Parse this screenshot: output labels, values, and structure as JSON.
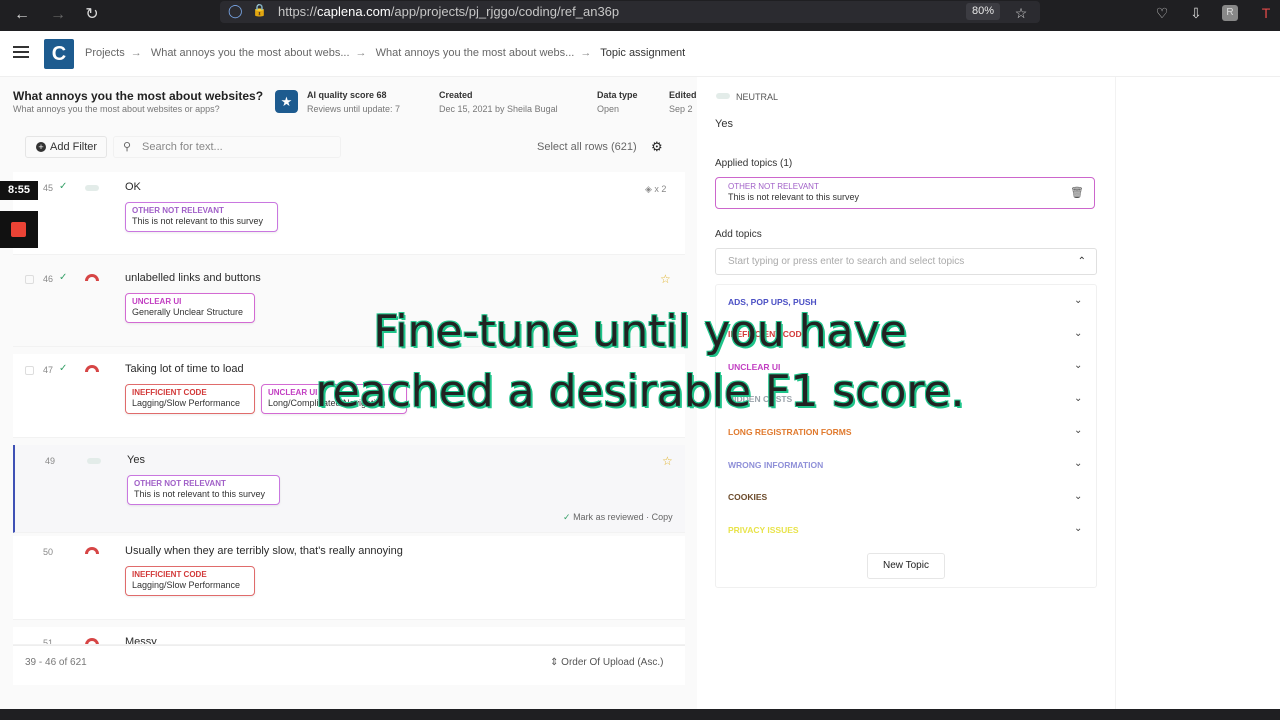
{
  "browser": {
    "url_prefix": "https://",
    "url_domain": "caplena.com",
    "url_path": "/app/projects/pj_rjggo/coding/ref_an36p",
    "zoom": "80%"
  },
  "breadcrumb": [
    "Projects",
    "What annoys you the most about webs...",
    "What annoys you the most about webs...",
    "Topic assignment"
  ],
  "project": {
    "title": "What annoys you the most about websites?",
    "subtitle": "What annoys you the most about websites or apps?",
    "ai_label": "AI quality score 68",
    "ai_sub": "Reviews until update: 7",
    "created_label": "Created",
    "created_value": "Dec 15, 2021 by Sheila Bugal",
    "datatype_label": "Data type",
    "datatype_value": "Open",
    "edited_label": "Edited",
    "edited_value": "Sep 2"
  },
  "toolbar": {
    "add_filter": "Add Filter",
    "search_placeholder": "Search for text...",
    "select_all": "Select all rows (621)"
  },
  "rows": [
    {
      "num": "45",
      "text": "OK",
      "extra": "x 2",
      "tags": [
        {
          "cat": "OTHER NOT RELEVANT",
          "label": "This is not relevant to this survey"
        }
      ]
    },
    {
      "num": "46",
      "text": "unlabelled links and buttons",
      "tags": [
        {
          "cat": "UNCLEAR UI",
          "label": "Generally Unclear Structure"
        }
      ]
    },
    {
      "num": "47",
      "text": "Taking lot of time to load",
      "tags": [
        {
          "cat": "INEFFICIENT CODE",
          "label": "Lagging/Slow Performance"
        },
        {
          "cat": "UNCLEAR UI",
          "label": "Long/Complicated Navigation"
        }
      ]
    },
    {
      "num": "49",
      "text": "Yes",
      "mark": "Mark as reviewed",
      "copy": "Copy",
      "tags": [
        {
          "cat": "OTHER NOT RELEVANT",
          "label": "This is not relevant to this survey"
        }
      ]
    },
    {
      "num": "50",
      "text": "Usually when they are terribly slow, that's really annoying",
      "tags": [
        {
          "cat": "INEFFICIENT CODE",
          "label": "Lagging/Slow Performance"
        }
      ]
    },
    {
      "num": "51",
      "text": "Messy"
    }
  ],
  "footer": {
    "range": "39 - 46 of 621",
    "order": "Order Of Upload (Asc.)"
  },
  "panel": {
    "sentiment": "NEUTRAL",
    "answer": "Yes",
    "applied_label": "Applied topics (1)",
    "applied_cat": "OTHER NOT RELEVANT",
    "applied_topic": "This is not relevant to this survey",
    "add_label": "Add topics",
    "add_placeholder": "Start typing or press enter to search and select topics",
    "topics": [
      {
        "name": "ADS, POP UPS, PUSH",
        "color": "#4a4fc4"
      },
      {
        "name": "INEFFICIENT CODE",
        "color": "#d23a3a"
      },
      {
        "name": "UNCLEAR UI",
        "color": "#c23fc2"
      },
      {
        "name": "HIDDEN COSTS",
        "color": "#9aa3aa"
      },
      {
        "name": "LONG REGISTRATION FORMS",
        "color": "#e07a2e"
      },
      {
        "name": "WRONG INFORMATION",
        "color": "#8f90d8"
      },
      {
        "name": "COOKIES",
        "color": "#6b4a2a"
      },
      {
        "name": "PRIVACY ISSUES",
        "color": "#e8e34a"
      }
    ],
    "new_topic": "New Topic"
  },
  "recorder": {
    "time": "8:55"
  },
  "caption": {
    "line1": "Fine-tune until you have",
    "line2": "reached a desirable F1 score."
  }
}
